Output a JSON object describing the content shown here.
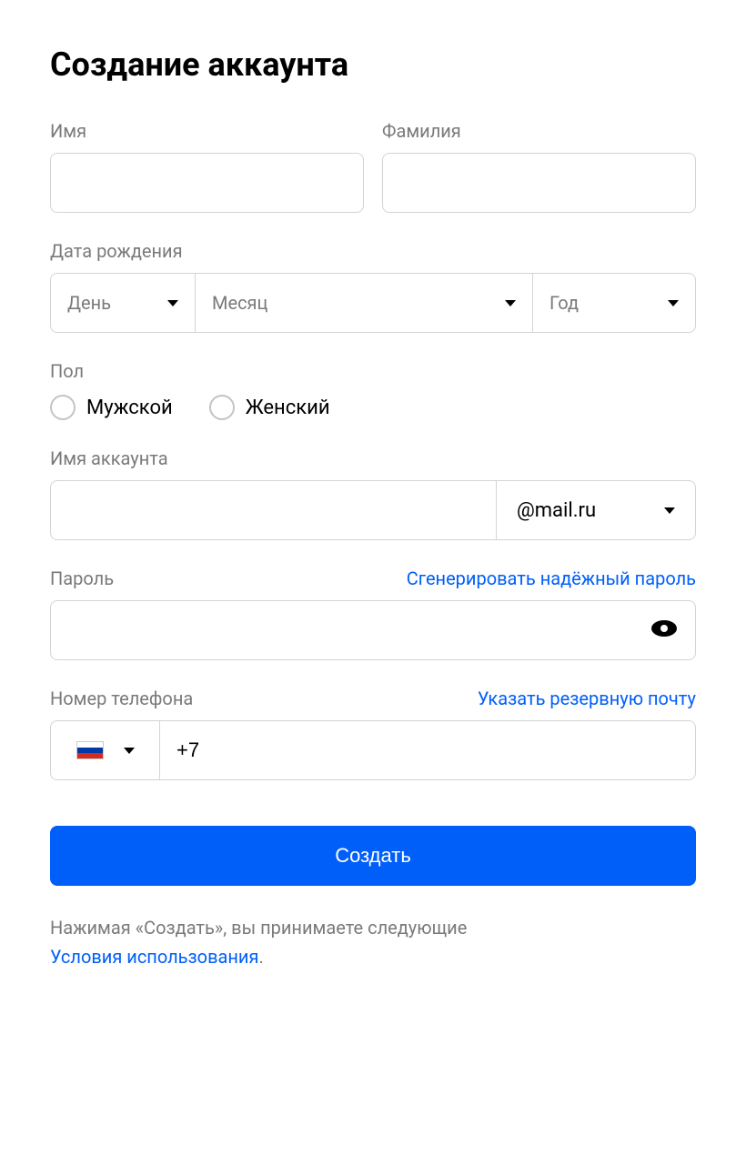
{
  "title": "Создание аккаунта",
  "firstName": {
    "label": "Имя"
  },
  "lastName": {
    "label": "Фамилия"
  },
  "birthDate": {
    "label": "Дата рождения",
    "day": "День",
    "month": "Месяц",
    "year": "Год"
  },
  "gender": {
    "label": "Пол",
    "male": "Мужской",
    "female": "Женский"
  },
  "account": {
    "label": "Имя аккаунта",
    "domain": "@mail.ru"
  },
  "password": {
    "label": "Пароль",
    "generateLink": "Сгенерировать надёжный пароль"
  },
  "phone": {
    "label": "Номер телефона",
    "backupLink": "Указать резервную почту",
    "prefix": "+7"
  },
  "submit": "Создать",
  "terms": {
    "text": "Нажимая «Создать», вы принимаете следующие",
    "link": "Условия использования",
    "dot": "."
  }
}
